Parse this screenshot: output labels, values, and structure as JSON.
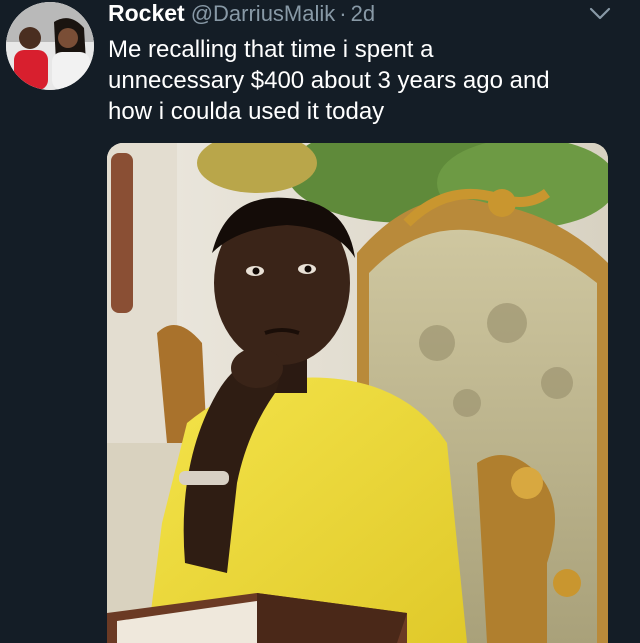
{
  "tweet": {
    "display_name": "Rocket",
    "handle": "@DarriusMalik",
    "separator": "·",
    "time": "2d",
    "text": "Me recalling that time i spent a\nunnecessary $400 about 3 years ago and\nhow i coulda used it today"
  },
  "icons": {
    "avatar": "avatar-photo",
    "menu": "chevron-down-icon"
  },
  "colors": {
    "background": "#141d26",
    "secondary_text": "#8899a6",
    "primary_text": "#ffffff"
  }
}
